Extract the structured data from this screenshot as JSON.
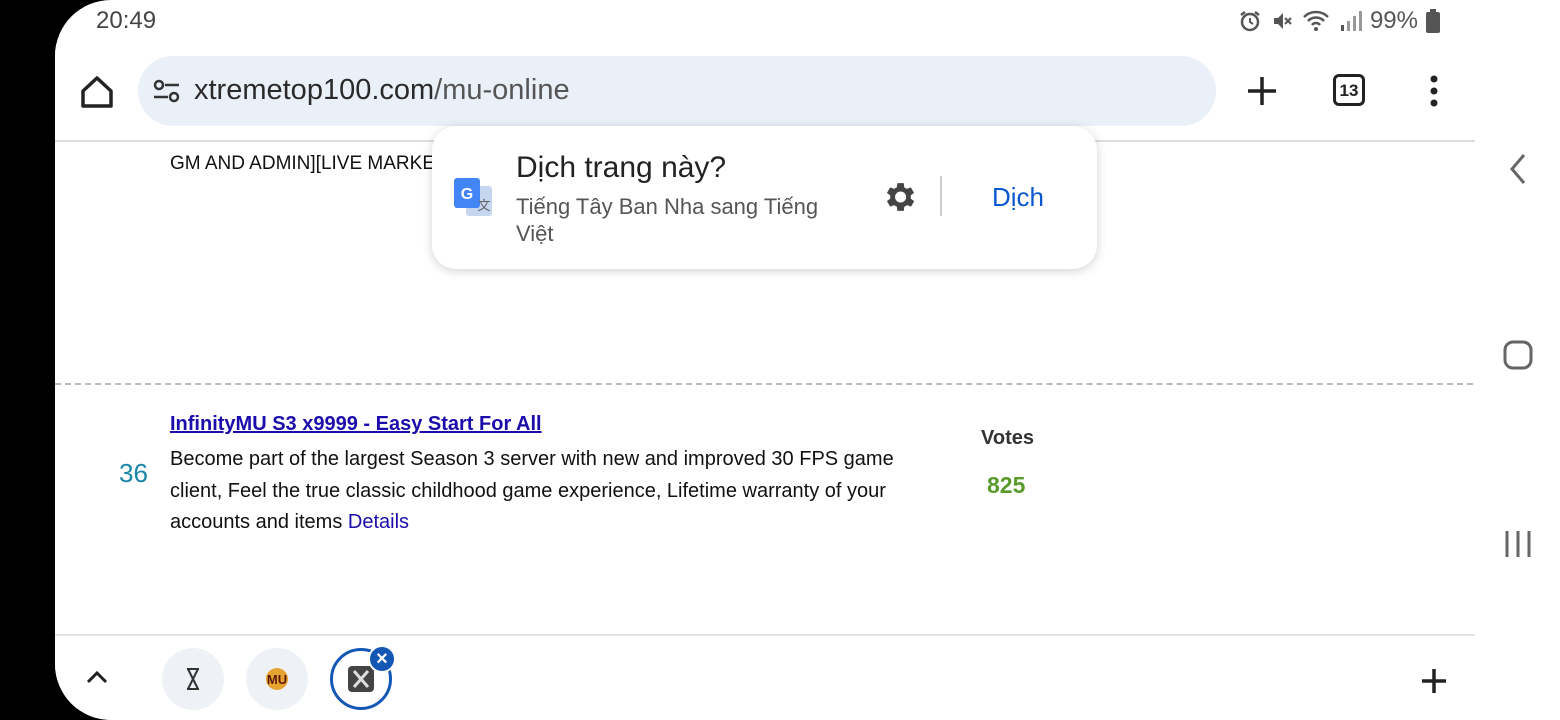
{
  "status_bar": {
    "time": "20:49",
    "battery": "99%",
    "icons": [
      "alarm-icon",
      "mute-icon",
      "wifi-icon",
      "signal-icon",
      "battery-icon"
    ]
  },
  "toolbar": {
    "url_domain": "xtremetop100.com",
    "url_path": "/mu-online",
    "tab_count": "13",
    "icons": [
      "home-icon",
      "site-settings-icon",
      "new-tab-icon",
      "tab-switcher-icon",
      "menu-icon"
    ]
  },
  "page": {
    "truncated_text": "GM AND ADMIN][LIVE MARKET]",
    "listing": {
      "rank": "36",
      "title": "InfinityMU S3 x9999 - Easy Start For All",
      "description": "Become part of the largest Season 3 server with new and improved 30 FPS game client, Feel the true classic childhood game experience, Lifetime warranty of your accounts and items ",
      "details_link": "Details",
      "votes_label": "Votes",
      "votes_value": "825"
    }
  },
  "translate_prompt": {
    "title": "Dịch trang này?",
    "subtitle": "Tiếng Tây Ban Nha sang Tiếng Việt",
    "translate_button": "Dịch",
    "icons": [
      "google-translate-icon",
      "settings-gear-icon"
    ]
  },
  "tab_strip": {
    "tabs": [
      {
        "name": "hourglass-favicon"
      },
      {
        "name": "mu-favicon"
      },
      {
        "name": "x-favicon",
        "active": true
      }
    ]
  },
  "colors": {
    "accent": "#0b57d0",
    "link": "#1a0dab",
    "rank": "#1a86a7",
    "votes": "#5a9a2c",
    "omnibox_bg": "#eaf0f8"
  }
}
